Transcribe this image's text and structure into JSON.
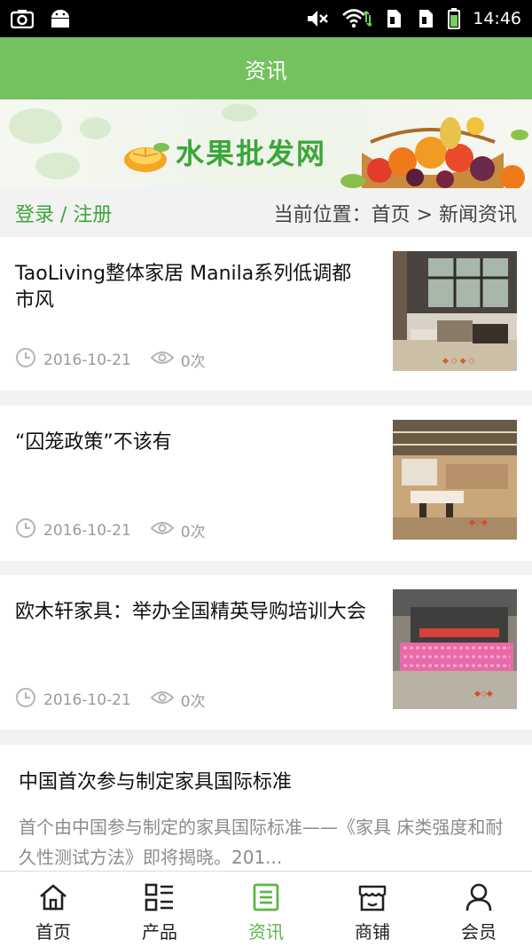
{
  "status_bar": {
    "time": "14:46",
    "icons": [
      "screenshot-icon",
      "android-icon",
      "mute-icon",
      "wifi-icon",
      "sim1-icon",
      "sim2-icon",
      "battery-icon"
    ]
  },
  "title_bar": {
    "title": "资讯"
  },
  "banner": {
    "site_name": "水果批发网"
  },
  "nav_row": {
    "login_register": "登录 / 注册",
    "breadcrumb": "当前位置：首页 > 新闻资讯"
  },
  "news": [
    {
      "title": "TaoLiving整体家居 Manila系列低调都市风",
      "date": "2016-10-21",
      "views": "0次"
    },
    {
      "title": "“囚笼政策”不该有",
      "date": "2016-10-21",
      "views": "0次"
    },
    {
      "title": "欧木轩家具：举办全国精英导购培训大会",
      "date": "2016-10-21",
      "views": "0次"
    }
  ],
  "text_item": {
    "title": "中国首次参与制定家具国际标准",
    "desc": " 首个由中国参与制定的家具国际标准——《家具 床类强度和耐久性测试方法》即将揭晓。201..."
  },
  "bottom_nav": [
    {
      "label": "首页",
      "icon": "home-icon",
      "active": false
    },
    {
      "label": "产品",
      "icon": "grid-list-icon",
      "active": false
    },
    {
      "label": "资讯",
      "icon": "news-icon",
      "active": true
    },
    {
      "label": "商铺",
      "icon": "shop-icon",
      "active": false
    },
    {
      "label": "会员",
      "icon": "user-icon",
      "active": false
    }
  ],
  "colors": {
    "accent": "#73c25f",
    "accent_text": "#3ca63a",
    "active_tab": "#5fb547"
  }
}
